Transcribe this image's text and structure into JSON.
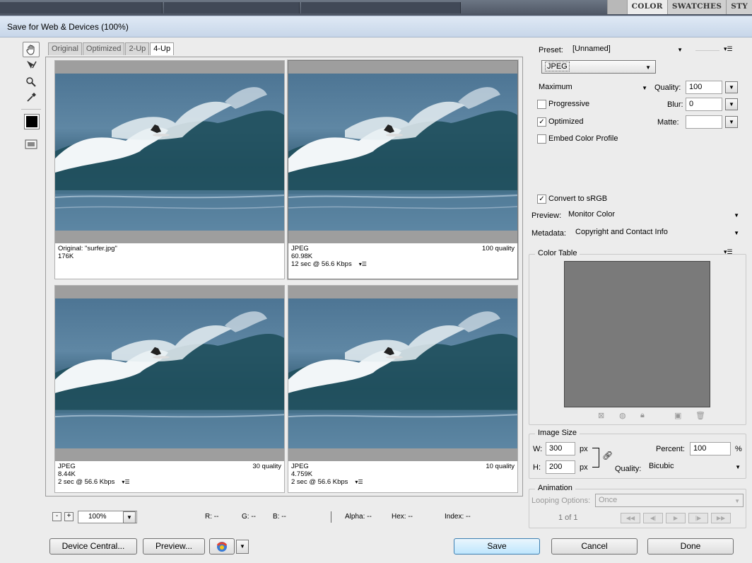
{
  "app": {
    "panel_tabs": [
      "COLOR",
      "SWATCHES",
      "STY"
    ],
    "dialog_title": "Save for Web & Devices (100%)"
  },
  "view_tabs": [
    "Original",
    "Optimized",
    "2-Up",
    "4-Up"
  ],
  "panes": [
    {
      "line1": "Original: \"surfer.jpg\"",
      "line2": "176K",
      "line3": "",
      "quality": ""
    },
    {
      "line1": "JPEG",
      "line2": "60.98K",
      "line3": "12 sec @ 56.6 Kbps",
      "quality": "100 quality"
    },
    {
      "line1": "JPEG",
      "line2": "8.44K",
      "line3": "2 sec @ 56.6 Kbps",
      "quality": "30 quality"
    },
    {
      "line1": "JPEG",
      "line2": "4.759K",
      "line3": "2 sec @ 56.6 Kbps",
      "quality": "10 quality"
    }
  ],
  "status": {
    "zoom_minus": "-",
    "zoom_plus": "+",
    "zoom": "100%",
    "r": "R: --",
    "g": "G: --",
    "b": "B: --",
    "alpha": "Alpha: --",
    "hex": "Hex: --",
    "index": "Index: --"
  },
  "buttons": {
    "device_central": "Device Central...",
    "preview": "Preview...",
    "save": "Save",
    "cancel": "Cancel",
    "done": "Done"
  },
  "settings": {
    "preset_label": "Preset:",
    "preset_value": "[Unnamed]",
    "format": "JPEG",
    "compression": "Maximum",
    "quality_label": "Quality:",
    "quality_value": "100",
    "progressive_label": "Progressive",
    "progressive_checked": false,
    "blur_label": "Blur:",
    "blur_value": "0",
    "optimized_label": "Optimized",
    "optimized_checked": true,
    "matte_label": "Matte:",
    "matte_value": "",
    "embed_label": "Embed Color Profile",
    "embed_checked": false,
    "srgb_label": "Convert to sRGB",
    "srgb_checked": true,
    "preview_label": "Preview:",
    "preview_value": "Monitor Color",
    "metadata_label": "Metadata:",
    "metadata_value": "Copyright and Contact Info",
    "color_table_label": "Color Table",
    "check_mark": "✓"
  },
  "image_size": {
    "title": "Image Size",
    "w_label": "W:",
    "w_value": "300",
    "h_label": "H:",
    "h_value": "200",
    "unit": "px",
    "percent_label": "Percent:",
    "percent_value": "100",
    "percent_unit": "%",
    "quality_label": "Quality:",
    "quality_value": "Bicubic"
  },
  "animation": {
    "title": "Animation",
    "looping_label": "Looping Options:",
    "looping_value": "Once",
    "frame": "1 of 1"
  },
  "icons": {
    "hand": "hand-tool-icon",
    "slice_select": "slice-select-tool-icon",
    "zoom": "zoom-tool-icon",
    "eyedropper": "eyedropper-tool-icon",
    "eyedropper_color": "#000000",
    "toggle_slices": "toggle-slices-icon",
    "browser": "browser-icon"
  },
  "colors": {
    "color_table_bg": "#7a7a7a",
    "accent": "#3c7fb1"
  }
}
